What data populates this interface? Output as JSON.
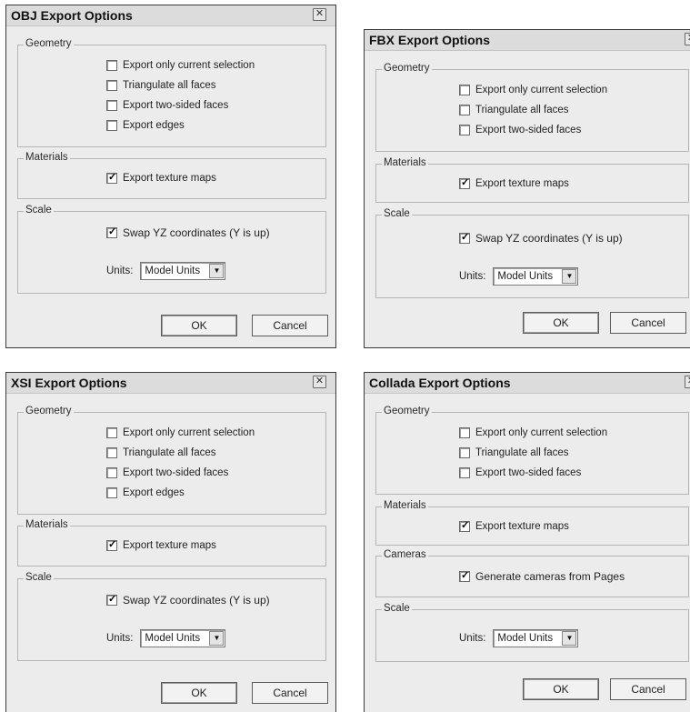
{
  "obj": {
    "title": "OBJ Export Options",
    "geometry_label": "Geometry",
    "geometry_options": [
      {
        "label": "Export only current selection",
        "checked": false
      },
      {
        "label": "Triangulate all faces",
        "checked": false
      },
      {
        "label": "Export two-sided faces",
        "checked": false
      },
      {
        "label": "Export edges",
        "checked": false
      }
    ],
    "materials_label": "Materials",
    "texture_maps": {
      "label": "Export texture maps",
      "checked": true
    },
    "scale_label": "Scale",
    "swap_yz": {
      "label": "Swap YZ coordinates (Y is up)",
      "checked": true
    },
    "units_label": "Units:",
    "units_value": "Model Units",
    "ok": "OK",
    "cancel": "Cancel"
  },
  "fbx": {
    "title": "FBX Export Options",
    "geometry_label": "Geometry",
    "geometry_options": [
      {
        "label": "Export only current selection",
        "checked": false
      },
      {
        "label": "Triangulate all faces",
        "checked": false
      },
      {
        "label": "Export two-sided faces",
        "checked": false
      }
    ],
    "materials_label": "Materials",
    "texture_maps": {
      "label": "Export texture maps",
      "checked": true
    },
    "scale_label": "Scale",
    "swap_yz": {
      "label": "Swap YZ coordinates (Y is up)",
      "checked": true
    },
    "units_label": "Units:",
    "units_value": "Model Units",
    "ok": "OK",
    "cancel": "Cancel"
  },
  "xsi": {
    "title": "XSI Export Options",
    "geometry_label": "Geometry",
    "geometry_options": [
      {
        "label": "Export only current selection",
        "checked": false
      },
      {
        "label": "Triangulate all faces",
        "checked": false
      },
      {
        "label": "Export two-sided faces",
        "checked": false
      },
      {
        "label": "Export edges",
        "checked": false
      }
    ],
    "materials_label": "Materials",
    "texture_maps": {
      "label": "Export texture maps",
      "checked": true
    },
    "scale_label": "Scale",
    "swap_yz": {
      "label": "Swap YZ coordinates (Y is up)",
      "checked": true
    },
    "units_label": "Units:",
    "units_value": "Model Units",
    "ok": "OK",
    "cancel": "Cancel"
  },
  "collada": {
    "title": "Collada Export Options",
    "geometry_label": "Geometry",
    "geometry_options": [
      {
        "label": "Export only current selection",
        "checked": false
      },
      {
        "label": "Triangulate all faces",
        "checked": false
      },
      {
        "label": "Export two-sided faces",
        "checked": false
      }
    ],
    "materials_label": "Materials",
    "texture_maps": {
      "label": "Export texture maps",
      "checked": true
    },
    "cameras_label": "Cameras",
    "cameras": {
      "label": "Generate cameras from Pages",
      "checked": true
    },
    "scale_label": "Scale",
    "units_label": "Units:",
    "units_value": "Model Units",
    "ok": "OK",
    "cancel": "Cancel"
  },
  "icons": {
    "close": "close-icon",
    "dropdown": "chevron-down-icon",
    "check": "checkmark-icon"
  }
}
